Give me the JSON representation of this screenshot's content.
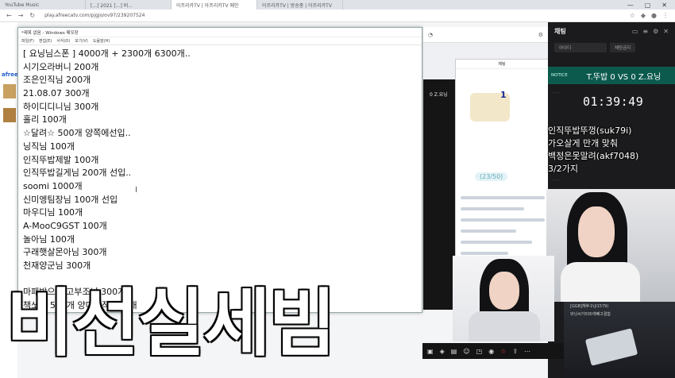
{
  "browser": {
    "tabs": [
      "YouTube Music",
      "[...] 2021 [...] 비...",
      "아프리카TV | 아프리카TV 메인",
      "아프리카TV | 방송중 | 아프리카TV"
    ],
    "url": "play.afreecatv.com/pjgjo/ov97/239207524",
    "window_controls": [
      "—",
      "▢",
      "✕"
    ]
  },
  "afreeca": {
    "logo": "afree"
  },
  "notepad": {
    "title": "*제목 없음 - Windows 메모장",
    "menu": [
      "파일(F)",
      "편집(E)",
      "서식(O)",
      "보기(V)",
      "도움말(H)"
    ],
    "lines": [
      "[ 요닝님스폰 ]  4000개    + 2300개  6300개..",
      "시기오라버니 200개",
      "조은인직님 200개",
      "21.08.07 300개",
      "하이디디니님 300개",
      "홀리 100개",
      "☆달려☆ 500개  양쪽에선입..",
      "닝직님 100개",
      "인직뚜밥제발 100개",
      "인직뚜밥길게님 200개  선입..",
      "soomi 1000개",
      "신미엥팀장님 100개  선입",
      "마우디님 100개",
      "A-MooC9GST 100개",
      "놀아님 100개",
      "구래햇살몬아님 300개",
      "천재양군님 300개",
      "",
      "마패박으면 고부조님 300개",
      "책쏘면 500개 양마인직 100개"
    ]
  },
  "mid_panel": {
    "dark_label": "0 Z.요닝",
    "chat_header": "채팅",
    "balloon_count": "1",
    "badge": "(23/50)"
  },
  "chat": {
    "header_title": "채팅",
    "tool_buttons": [
      "아이디",
      "채팅금지"
    ],
    "notice_tag": "NOTICE",
    "score_text": "T.뚜밥 0 VS 0 Z.요닝",
    "timer": "01:39:49",
    "big_lines": [
      "인직뚜밥뚜껑(suk79i)",
      "가오살게 만개 맞춰",
      "백정은못말려(akf7048)",
      "3/2가지"
    ],
    "bottom_msgs": [
      "[GGB]해후구(jl1579)",
      "와닝씨가500개빼고결함"
    ]
  },
  "caption": "비선실세빔"
}
